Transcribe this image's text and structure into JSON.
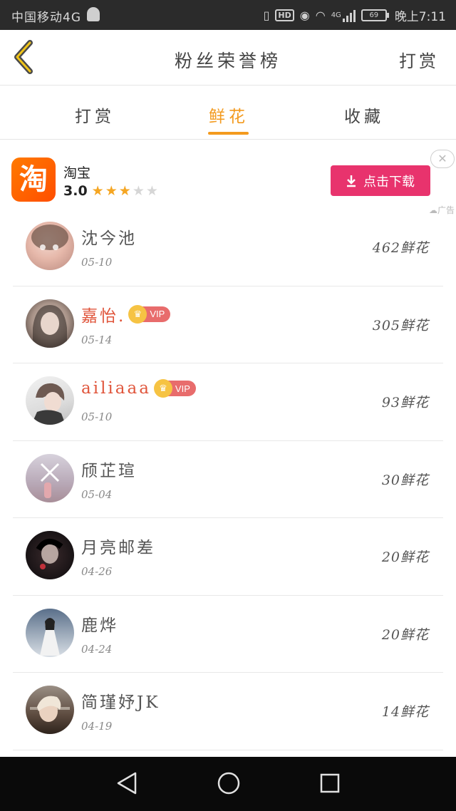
{
  "status_bar": {
    "carrier": "中国移动4G",
    "network": "4G",
    "battery": "69",
    "time": "晚上7:11"
  },
  "header": {
    "title": "粉丝荣誉榜",
    "right_action": "打赏"
  },
  "tabs": [
    {
      "label": "打赏",
      "active": false
    },
    {
      "label": "鲜花",
      "active": true
    },
    {
      "label": "收藏",
      "active": false
    }
  ],
  "accent_color": "#f39a1e",
  "ad": {
    "logo_text": "淘",
    "app_name": "淘宝",
    "rating": "3.0",
    "stars_filled": 3,
    "stars_total": 5,
    "button_label": "点击下载",
    "close_symbol": "✕",
    "tag": "广告"
  },
  "fans": [
    {
      "name": "沈今池",
      "date": "05-10",
      "count": "462鲜花",
      "vip": false
    },
    {
      "name": "嘉怡.",
      "date": "05-14",
      "count": "305鲜花",
      "vip": true,
      "vip_label": "VIP"
    },
    {
      "name": "ailiaaa",
      "date": "05-10",
      "count": "93鲜花",
      "vip": true,
      "vip_label": "VIP"
    },
    {
      "name": "颀芷瑄",
      "date": "05-04",
      "count": "30鲜花",
      "vip": false
    },
    {
      "name": "月亮邮差",
      "date": "04-26",
      "count": "20鲜花",
      "vip": false
    },
    {
      "name": "鹿烨",
      "date": "04-24",
      "count": "20鲜花",
      "vip": false
    },
    {
      "name": "简瑾妤JK",
      "date": "04-19",
      "count": "14鲜花",
      "vip": false
    }
  ]
}
